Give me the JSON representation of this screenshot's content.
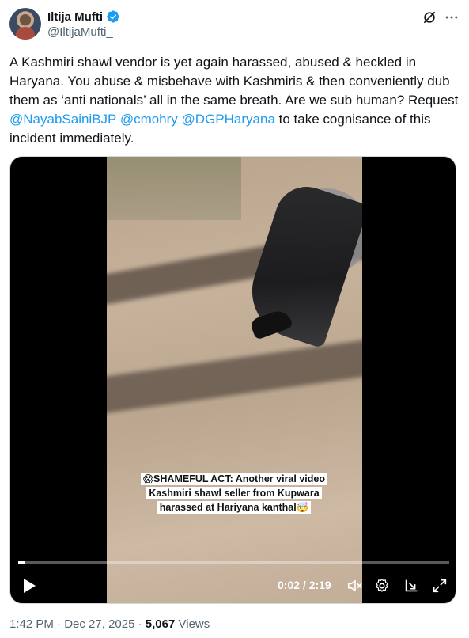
{
  "author": {
    "display_name": "Iltija Mufti",
    "handle": "@IltijaMufti_",
    "verified": true,
    "verified_color": "#1d9bf0"
  },
  "header_icons": [
    "grok-icon",
    "more-icon"
  ],
  "tweet": {
    "text_before": "A Kashmiri shawl vendor is yet again harassed, abused & heckled in Haryana. You abuse & misbehave with Kashmiris & then conveniently dub them as ‘anti nationals’ all in the same breath. Are we sub human? Request ",
    "mention_1": "@NayabSainiBJP",
    "sep_1": " ",
    "mention_2": "@cmohry",
    "sep_2": " ",
    "mention_3": "@DGPHaryana",
    "text_after": " to take cognisance of this incident immediately.",
    "mention_color": "#1d9bf0"
  },
  "video": {
    "caption_line_1": "😱SHAMEFUL ACT: Another viral video",
    "caption_line_2": "Kashmiri shawl seller from Kupwara",
    "caption_line_3": "harassed at Hariyana kanthal🤯",
    "current_time": "0:02",
    "duration": "2:19",
    "time_display": "0:02 / 2:19",
    "progress_fraction": 0.014,
    "controls": [
      "play-icon",
      "mute-icon",
      "settings-icon",
      "pop-out-icon",
      "fullscreen-icon"
    ]
  },
  "meta": {
    "time": "1:42 PM",
    "dot_1": " · ",
    "date": "Dec 27, 2025",
    "dot_2": " · ",
    "views_count": "5,067",
    "views_label": " Views"
  }
}
